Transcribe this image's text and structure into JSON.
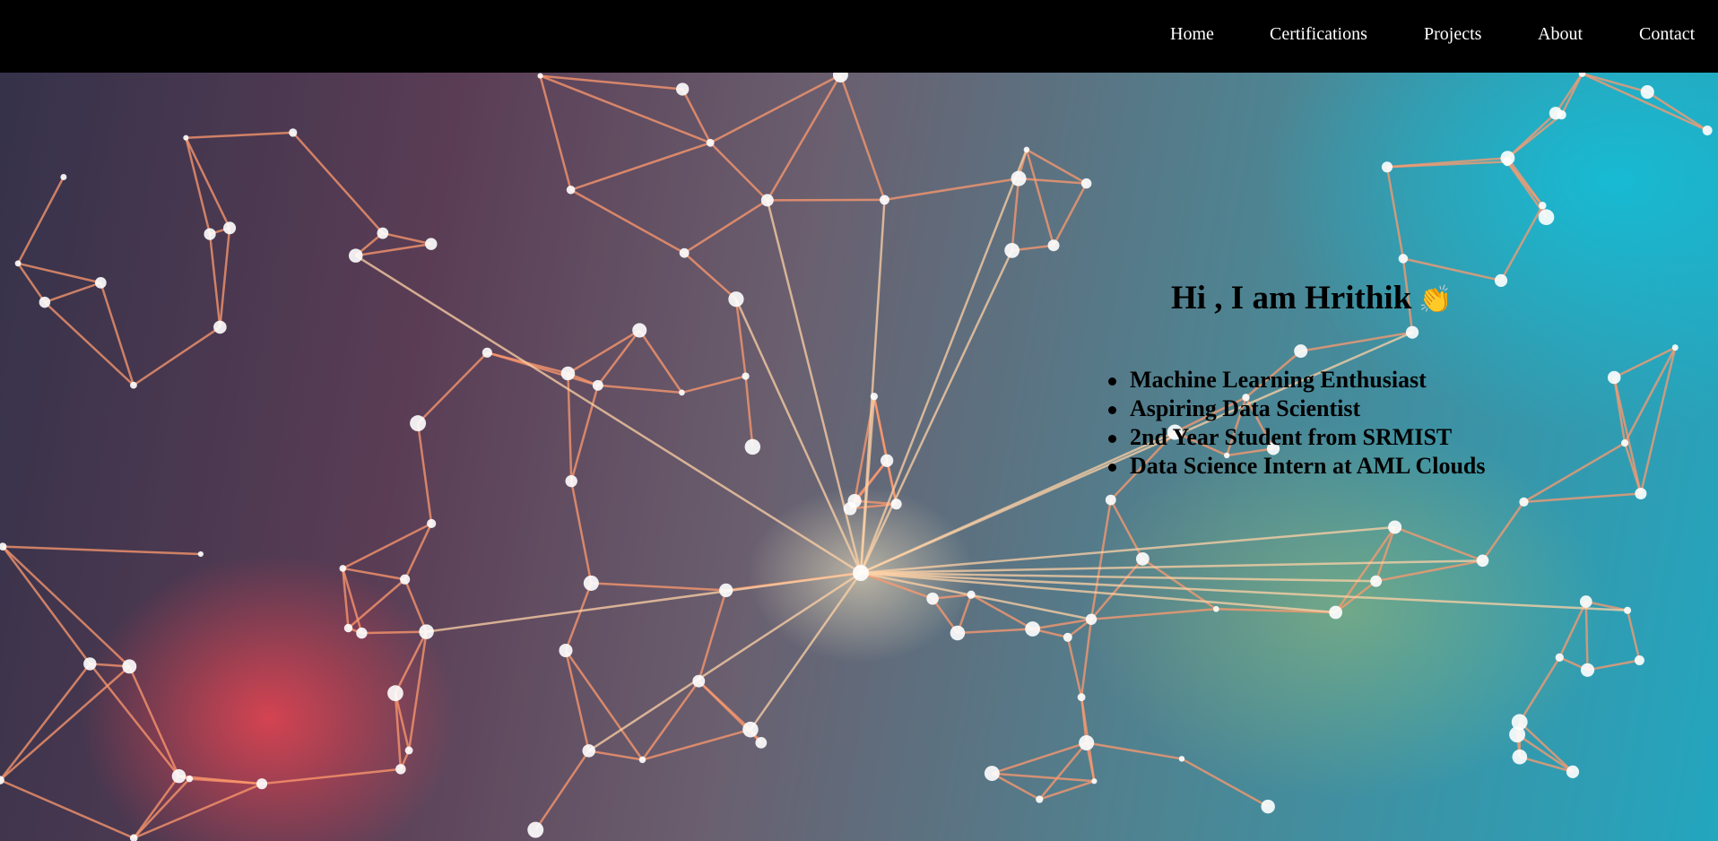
{
  "nav": {
    "items": [
      {
        "label": "Home"
      },
      {
        "label": "Certifications"
      },
      {
        "label": "Projects"
      },
      {
        "label": "About"
      },
      {
        "label": "Contact"
      }
    ]
  },
  "hero": {
    "greeting": "Hi , I am Hrithik",
    "greeting_emoji": "👏",
    "highlights": [
      "Machine Learning Enthusiast",
      "Aspiring Data Scientist",
      "2nd Year Student from SRMIST",
      "Data Science Intern at AML Clouds"
    ],
    "background_colors": {
      "navbar": "#000000",
      "warm": "#ff4650",
      "cool": "#14bed7",
      "lines": "#ff9a6e"
    }
  }
}
